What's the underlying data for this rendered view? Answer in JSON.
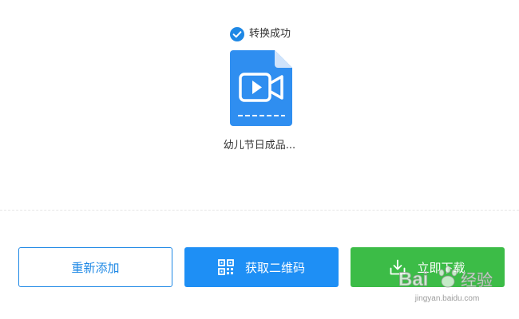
{
  "status": {
    "text": "转换成功",
    "icon": "check-circle-icon",
    "color": "#1e88e5"
  },
  "file": {
    "name": "幼儿节日成品...",
    "icon": "video-file-icon",
    "color": "#2f8ef0"
  },
  "buttons": {
    "readd_label": "重新添加",
    "qrcode_label": "获取二维码",
    "download_label": "立即下载"
  },
  "colors": {
    "primary": "#1e88e5",
    "qr_button": "#1e8ff5",
    "download_button": "#3cbc47"
  },
  "watermark": {
    "text": "Bai 经验",
    "url": "jingyan.baidu.com"
  }
}
